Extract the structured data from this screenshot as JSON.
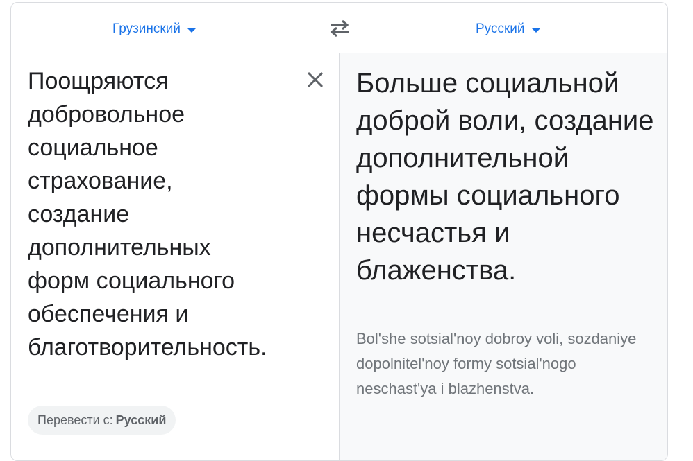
{
  "languages": {
    "source": "Грузинский",
    "target": "Русский"
  },
  "source": {
    "text": "Поощряются добровольное социальное страхование, создание дополнительных форм социального обеспечения и благотворительность.",
    "detected_prefix": "Перевести с:",
    "detected_language": "Русский"
  },
  "target": {
    "translation": "Больше социальной доброй воли, создание дополнительной формы социального несчастья и блаженства.",
    "transliteration": "Bol'she sotsial'noy dobroy voli, sozdaniye dopolnitel'noy formy sotsial'nogo neschast'ya i blazhenstva."
  },
  "icons": {
    "dropdown": "chevron-down-icon",
    "swap": "swap-languages-icon",
    "clear": "close-icon"
  },
  "colors": {
    "accent": "#1a73e8",
    "text": "#202124",
    "muted": "#70757a",
    "border": "#dadce0",
    "panel_bg": "#f8f9fa"
  }
}
